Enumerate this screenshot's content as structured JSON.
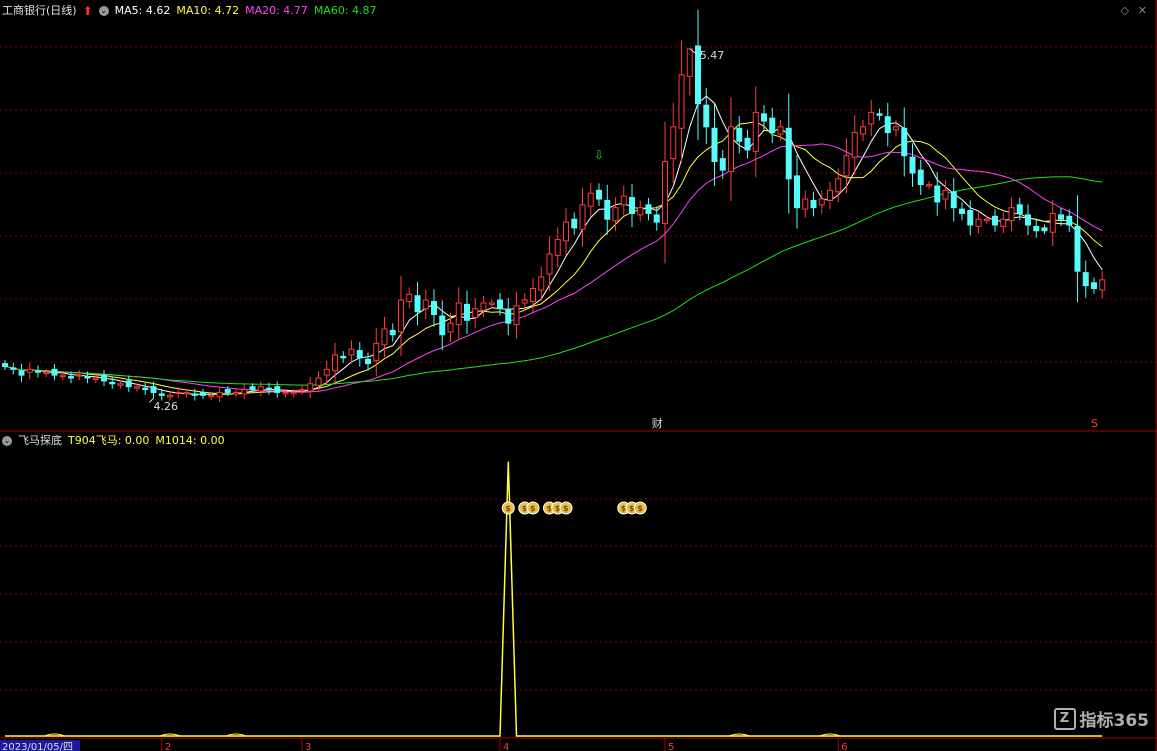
{
  "header": {
    "stock_name": "工商银行(日线)",
    "ma5": "MA5: 4.62",
    "ma10": "MA10: 4.72",
    "ma20": "MA20: 4.77",
    "ma60": "MA60: 4.87"
  },
  "indicator_header": {
    "name": "飞马探底",
    "t904": "T904飞马: 0.00",
    "m1014": "M1014: 0.00"
  },
  "icons": {
    "up_arrow": "up-arrow-icon",
    "toggle": "circle-toggle-icon",
    "diamond": "diamond-icon",
    "close": "close-icon",
    "moneybag": "money-bag-icon",
    "buy_arrow": "down-arrow-icon"
  },
  "colors": {
    "up": "#ff3b3b",
    "down": "#54fcfc",
    "ma5": "#ffffff",
    "ma10": "#ffff40",
    "ma20": "#ff40ff",
    "ma60": "#22dd22",
    "grid": "#7a0000",
    "border": "#aa0000",
    "indicator": "#ffff40",
    "date_text": "#ff3b3b"
  },
  "markers": {
    "high_label": "5.47",
    "low_label": "4.26",
    "cai_label": "财",
    "s_label": "S",
    "date_first": "2023/01/05/四"
  },
  "watermark": {
    "logo": "Z",
    "text": "指标365"
  },
  "chart_data": [
    {
      "type": "candlestick",
      "title": "工商银行(日线)",
      "ylim": [
        4.15,
        5.57
      ],
      "grid": true,
      "x_month_labels": [
        {
          "index": 0,
          "label": "2023/01/05/四"
        },
        {
          "index": 19,
          "label": "2"
        },
        {
          "index": 36,
          "label": "3"
        },
        {
          "index": 60,
          "label": "4"
        },
        {
          "index": 80,
          "label": "5"
        },
        {
          "index": 101,
          "label": "6"
        }
      ],
      "close": [
        4.37,
        4.36,
        4.34,
        4.36,
        4.35,
        4.35,
        4.34,
        4.34,
        4.33,
        4.34,
        4.33,
        4.33,
        4.32,
        4.31,
        4.31,
        4.3,
        4.3,
        4.29,
        4.28,
        4.27,
        4.27,
        4.28,
        4.28,
        4.27,
        4.27,
        4.27,
        4.28,
        4.28,
        4.28,
        4.29,
        4.29,
        4.3,
        4.29,
        4.28,
        4.28,
        4.28,
        4.29,
        4.31,
        4.33,
        4.36,
        4.41,
        4.4,
        4.43,
        4.4,
        4.38,
        4.45,
        4.5,
        4.48,
        4.6,
        4.62,
        4.56,
        4.6,
        4.55,
        4.48,
        4.52,
        4.59,
        4.53,
        4.57,
        4.59,
        4.59,
        4.57,
        4.52,
        4.58,
        4.6,
        4.64,
        4.68,
        4.76,
        4.81,
        4.87,
        4.85,
        4.93,
        4.97,
        4.95,
        4.88,
        4.92,
        4.96,
        4.9,
        4.92,
        4.9,
        4.87,
        5.08,
        5.2,
        5.38,
        5.47,
        5.28,
        5.2,
        5.08,
        5.05,
        5.2,
        5.15,
        5.12,
        5.25,
        5.22,
        5.18,
        5.2,
        5.02,
        4.92,
        4.95,
        4.92,
        4.95,
        4.98,
        5.02,
        5.1,
        5.18,
        5.2,
        5.25,
        5.24,
        5.18,
        5.2,
        5.1,
        5.04,
        5.0,
        5.0,
        4.94,
        4.98,
        4.92,
        4.9,
        4.86,
        4.88,
        4.88,
        4.86,
        4.88,
        4.92,
        4.9,
        4.86,
        4.84,
        4.84,
        4.9,
        4.88,
        4.86,
        4.7,
        4.65,
        4.64,
        4.67
      ]
    },
    {
      "type": "line",
      "title": "飞马探底",
      "series": [
        {
          "name": "T904飞马",
          "peak_index": 61,
          "peak_value": 1.0
        }
      ],
      "ylim": [
        0,
        1.05
      ],
      "signal_icons_at": [
        61,
        63,
        64,
        66,
        67,
        68,
        75,
        76,
        77
      ]
    }
  ]
}
